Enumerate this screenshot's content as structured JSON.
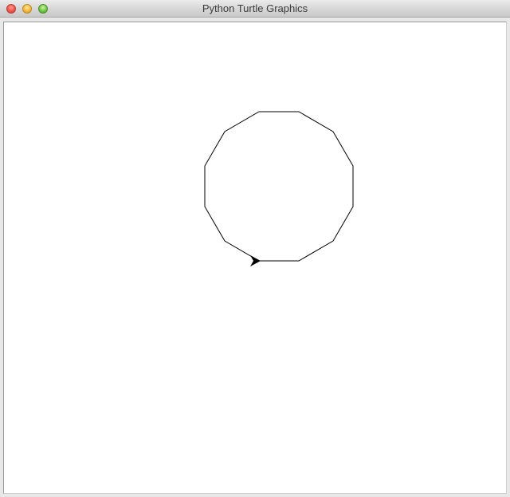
{
  "window": {
    "title": "Python Turtle Graphics"
  },
  "canvas": {
    "background": "#ffffff",
    "pen_color": "#000000",
    "shape": {
      "type": "regular-polygon",
      "sides": 12
    },
    "turtle": {
      "icon": "turtle-arrow-icon",
      "color": "#000000"
    }
  }
}
